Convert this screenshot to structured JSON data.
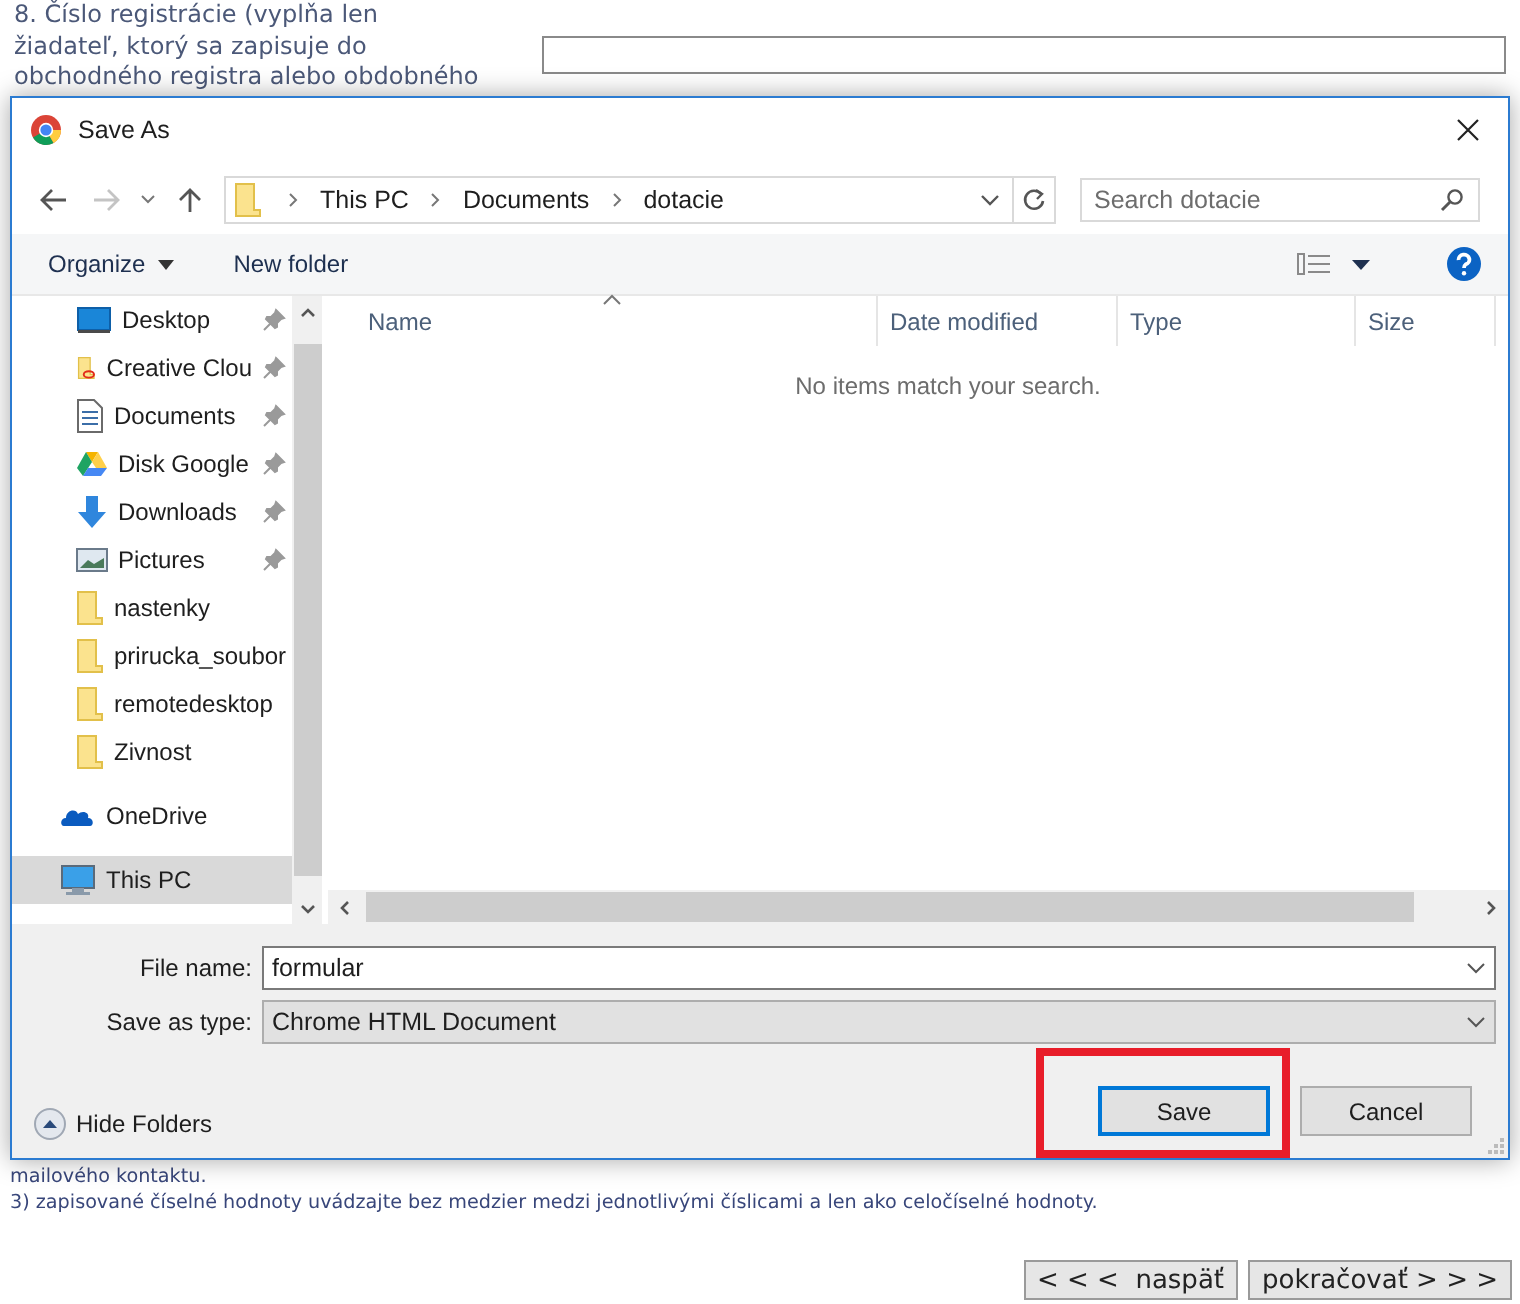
{
  "form": {
    "field_label_lines": [
      "8. Číslo registrácie (vyplňa len",
      "žiadateľ, ktorý sa zapisuje do",
      "obchodného registra alebo obdobného"
    ]
  },
  "dialog": {
    "title": "Save As",
    "breadcrumb": [
      "This PC",
      "Documents",
      "dotacie"
    ],
    "search": {
      "placeholder": "Search dotacie"
    },
    "toolbar": {
      "organize": "Organize",
      "new_folder": "New folder"
    },
    "nav_items": [
      {
        "label": "Desktop",
        "kind": "desktop",
        "pinned": true,
        "selected": false
      },
      {
        "label": "Creative Clou",
        "kind": "creative-cloud",
        "pinned": true,
        "selected": false
      },
      {
        "label": "Documents",
        "kind": "document",
        "pinned": true,
        "selected": false
      },
      {
        "label": "Disk Google",
        "kind": "drive",
        "pinned": true,
        "selected": false
      },
      {
        "label": "Downloads",
        "kind": "download",
        "pinned": true,
        "selected": false
      },
      {
        "label": "Pictures",
        "kind": "pictures",
        "pinned": true,
        "selected": false
      },
      {
        "label": "nastenky",
        "kind": "folder",
        "pinned": false,
        "selected": false
      },
      {
        "label": "prirucka_soubor",
        "kind": "folder",
        "pinned": false,
        "selected": false
      },
      {
        "label": "remotedesktop",
        "kind": "folder",
        "pinned": false,
        "selected": false
      },
      {
        "label": "Zivnost",
        "kind": "folder",
        "pinned": false,
        "selected": false
      },
      {
        "label": "OneDrive",
        "kind": "onedrive",
        "pinned": false,
        "selected": false
      },
      {
        "label": "This PC",
        "kind": "pc",
        "pinned": false,
        "selected": true
      }
    ],
    "columns": [
      {
        "label": "Name",
        "sorted": true
      },
      {
        "label": "Date modified",
        "sorted": false
      },
      {
        "label": "Type",
        "sorted": false
      },
      {
        "label": "Size",
        "sorted": false
      }
    ],
    "empty_message": "No items match your search.",
    "file_name": {
      "label": "File name:",
      "value": "formular"
    },
    "save_type": {
      "label": "Save as type:",
      "value": "Chrome HTML Document"
    },
    "hide_folders": "Hide Folders",
    "buttons": [
      {
        "label": "Save",
        "focused": true,
        "highlighted": true
      },
      {
        "label": "Cancel",
        "focused": false,
        "highlighted": false
      }
    ]
  },
  "notes": [
    "mailového kontaktu.",
    "3) zapisované číselné hodnoty uvádzajte bez medzier medzi jednotlivými číslicami a len ako celočíselné hodnoty."
  ],
  "nav_buttons": [
    "< < <  naspäť",
    "pokračovať > > >"
  ]
}
